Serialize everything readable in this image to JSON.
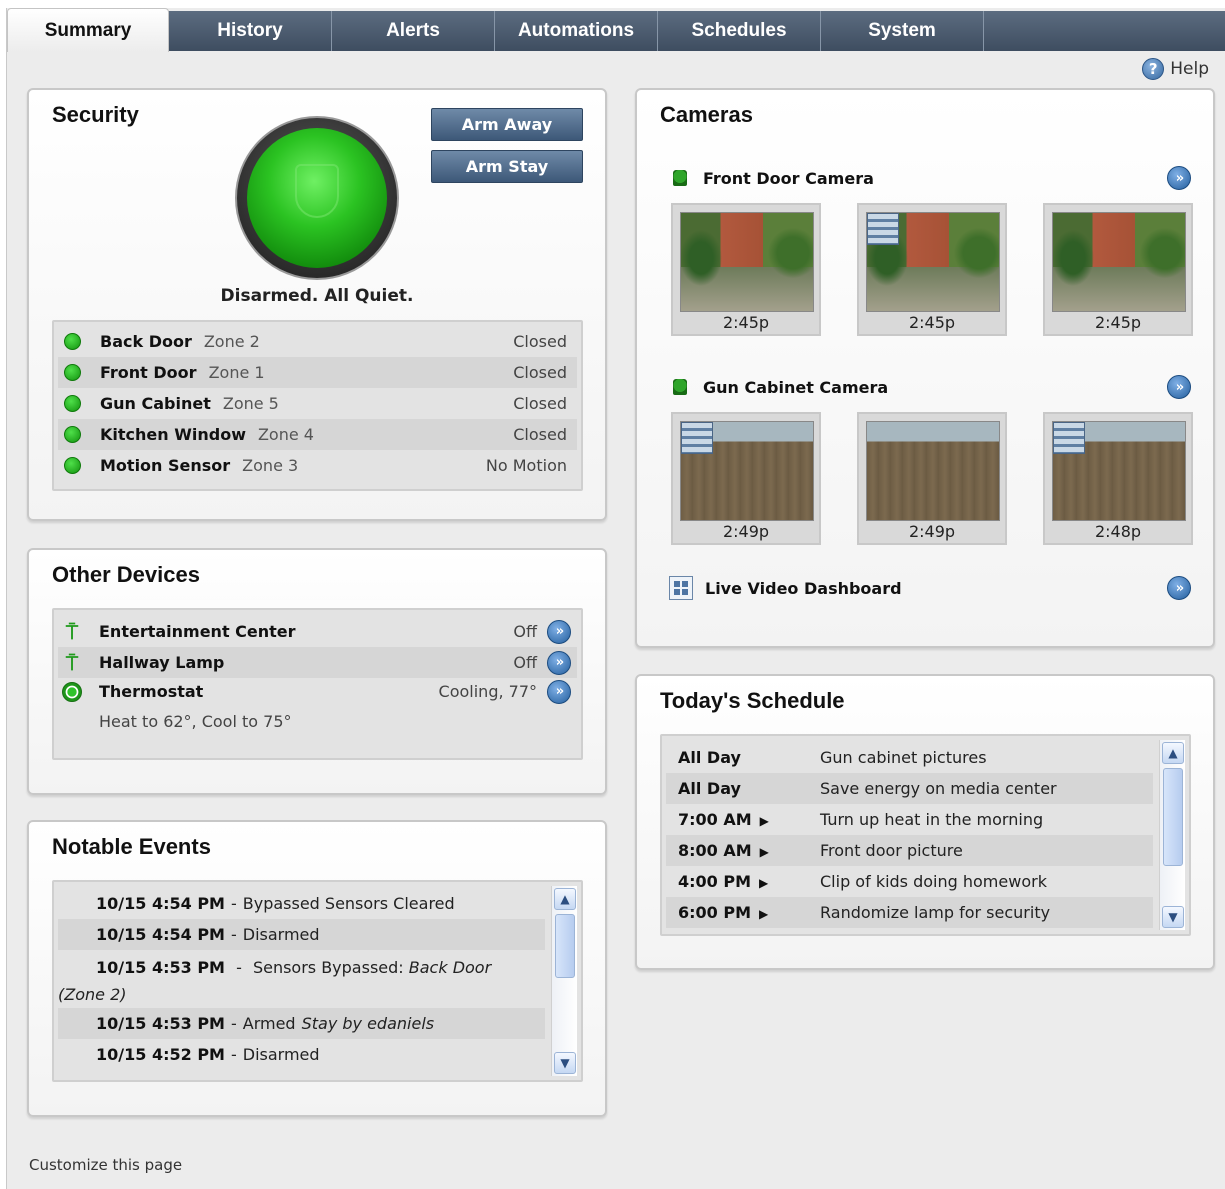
{
  "tabs": [
    "Summary",
    "History",
    "Alerts",
    "Automations",
    "Schedules",
    "System"
  ],
  "active_tab": "Summary",
  "help_label": "Help",
  "security": {
    "title": "Security",
    "arm_away_label": "Arm Away",
    "arm_stay_label": "Arm Stay",
    "status_text": "Disarmed. All Quiet.",
    "status_color": "#22a31d",
    "sensors": [
      {
        "name": "Back Door",
        "zone": "Zone 2",
        "state": "Closed"
      },
      {
        "name": "Front Door",
        "zone": "Zone 1",
        "state": "Closed"
      },
      {
        "name": "Gun Cabinet",
        "zone": "Zone 5",
        "state": "Closed"
      },
      {
        "name": "Kitchen Window",
        "zone": "Zone 4",
        "state": "Closed"
      },
      {
        "name": "Motion Sensor",
        "zone": "Zone 3",
        "state": "No Motion"
      }
    ]
  },
  "other_devices": {
    "title": "Other Devices",
    "devices": [
      {
        "name": "Entertainment Center",
        "state": "Off",
        "icon": "lamp-icon"
      },
      {
        "name": "Hallway Lamp",
        "state": "Off",
        "icon": "lamp-icon"
      },
      {
        "name": "Thermostat",
        "state": "Cooling, 77°",
        "icon": "thermostat-icon",
        "detail": "Heat to 62°, Cool to 75°"
      }
    ]
  },
  "events": {
    "title": "Notable Events",
    "items": [
      {
        "time": "10/15 4:54 PM",
        "text": "Bypassed Sensors Cleared"
      },
      {
        "time": "10/15 4:54 PM",
        "text": "Disarmed"
      },
      {
        "time": "10/15 4:53 PM",
        "text": "Sensors Bypassed:",
        "italic": "Back Door",
        "italic2": "(Zone 2)"
      },
      {
        "time": "10/15 4:53 PM",
        "text": "Armed",
        "italic": "Stay by edaniels"
      },
      {
        "time": "10/15 4:52 PM",
        "text": "Disarmed"
      }
    ]
  },
  "cameras": {
    "title": "Cameras",
    "front_door": {
      "name": "Front Door Camera",
      "clips": [
        "2:45p",
        "2:45p",
        "2:45p"
      ]
    },
    "gun_cabinet": {
      "name": "Gun Cabinet Camera",
      "clips": [
        "2:49p",
        "2:49p",
        "2:48p"
      ]
    },
    "live_dashboard_label": "Live Video Dashboard"
  },
  "schedule": {
    "title": "Today's Schedule",
    "items": [
      {
        "time": "All Day",
        "task": "Gun cabinet pictures",
        "arrow": false
      },
      {
        "time": "All Day",
        "task": "Save energy on media center",
        "arrow": false
      },
      {
        "time": "7:00 AM",
        "task": "Turn up heat in the morning",
        "arrow": true
      },
      {
        "time": "8:00 AM",
        "task": "Front door picture",
        "arrow": true
      },
      {
        "time": "4:00 PM",
        "task": "Clip of kids doing homework",
        "arrow": true
      },
      {
        "time": "6:00 PM",
        "task": "Randomize lamp for security",
        "arrow": true
      }
    ]
  },
  "footer_link": "Customize this page"
}
